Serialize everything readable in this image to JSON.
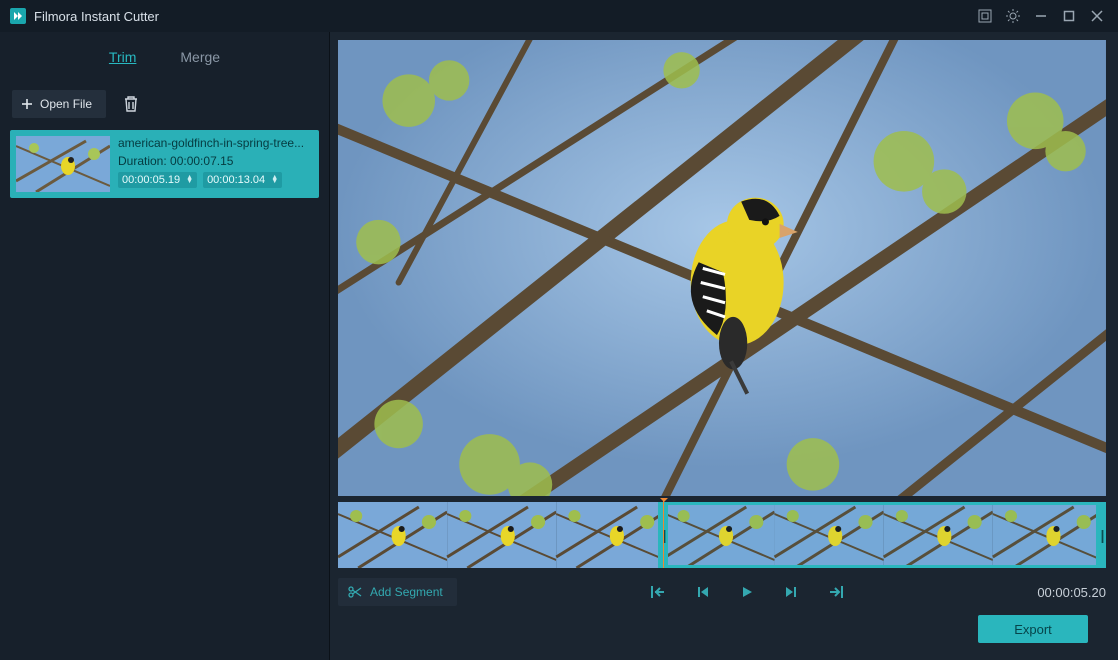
{
  "title": "Filmora Instant Cutter",
  "tabs": {
    "trim": "Trim",
    "merge": "Merge"
  },
  "openFile": "Open File",
  "clip": {
    "title": "american-goldfinch-in-spring-tree...",
    "durationLabel": "Duration: 00:00:07.15",
    "in": "00:00:05.19",
    "out": "00:00:13.04"
  },
  "addSegment": "Add Segment",
  "currentTime": "00:00:05.20",
  "export": "Export"
}
